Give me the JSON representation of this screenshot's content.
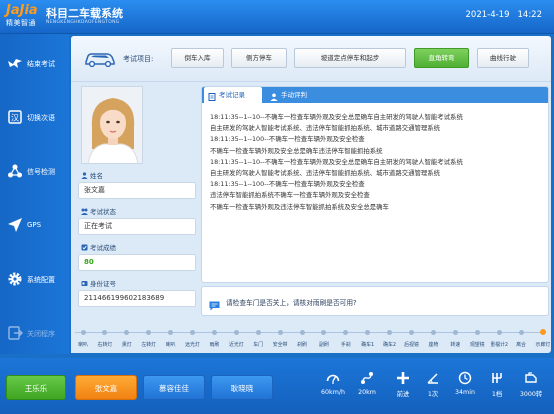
{
  "header": {
    "logo_top": "JaJia",
    "logo_bottom": "精美智通",
    "title": "科目二车载系统",
    "subtitle": "NENGKENGHKDAOFENGTONG",
    "date": "2021-4-19",
    "time": "14:22"
  },
  "sidebar": {
    "items": [
      {
        "label": "结束考试",
        "icon": "bird-icon"
      },
      {
        "label": "切换次语",
        "icon": "switch-language-icon"
      },
      {
        "label": "信号检测",
        "icon": "signal-nodes-icon"
      },
      {
        "label": "GPS",
        "icon": "gps-arrow-icon"
      },
      {
        "label": "系统配置",
        "icon": "gear-icon"
      },
      {
        "label": "关闭程序",
        "icon": "exit-icon"
      }
    ]
  },
  "subject_bar": {
    "label": "考试项目:",
    "buttons": [
      "倒车入库",
      "侧方停车",
      "坡道定点停车和起步",
      "直角转弯",
      "曲线行驶"
    ],
    "active_index": 3
  },
  "candidate": {
    "name_label": "姓名",
    "name": "张文嘉",
    "status_label": "考试状态",
    "status": "正在考试",
    "score_label": "考试成绩",
    "score": "80",
    "id_label": "身份证号",
    "id_number": "211466199602183689"
  },
  "record": {
    "tabs": [
      "考试记录",
      "手动评判"
    ],
    "lines": [
      "18:11:35--1--10--不确车一检查车辆外观及安全总是确车自主研发的驾驶人智能考试系统",
      "自主研发的驾驶人智能考试系统、违法停车智能抓拍系统、城市道路交通管理系统",
      "18:11:35--1--100--不确车一检查车辆外观及安全检查",
      "不确车一检查车辆外观及安全总是确车违法停车智能抓拍系统",
      "18:11:35--1--10--不确车一检查车辆外观及安全总是确车自主研发的驾驶人智能考试系统",
      "自主研发的驾驶人智能考试系统、违法停车智能抓拍系统、城市道路交通管理系统",
      "18:11:35--1--100--不确车一检查车辆外观及安全检查",
      "违法停车智能抓拍系统不确车一检查车辆外观及安全检查",
      "不确车一检查车辆外观及违法停车智能抓拍系统及安全总是确车"
    ]
  },
  "hint": {
    "text": "请检查车门是否关上，请核对雨刷是否可用?"
  },
  "steps": {
    "items": [
      "喇叭",
      "右转灯",
      "熏灯",
      "左转灯",
      "喇叭",
      "远光灯",
      "雨刷",
      "近光灯",
      "车门",
      "安全带",
      "刹刷",
      "副刷",
      "手刹",
      "确车1",
      "确车2",
      "后视镜",
      "座椅",
      "转速",
      "观望镜",
      "重檔计2",
      "离合",
      "示廊灯"
    ],
    "done_index": 21
  },
  "footer": {
    "buttons": [
      "王乐乐",
      "张文嘉",
      "慕容佳佳",
      "耿晓晓"
    ],
    "stats": [
      {
        "icon": "speedometer-icon",
        "value": "60km/h"
      },
      {
        "icon": "route-icon",
        "value": "20km"
      },
      {
        "icon": "crossroad-icon",
        "value": "前进"
      },
      {
        "icon": "angle-icon",
        "value": "1次"
      },
      {
        "icon": "clock-icon",
        "value": "34min"
      },
      {
        "icon": "gear-shift-icon",
        "value": "1档"
      },
      {
        "icon": "engine-icon",
        "value": "3000转"
      }
    ]
  }
}
